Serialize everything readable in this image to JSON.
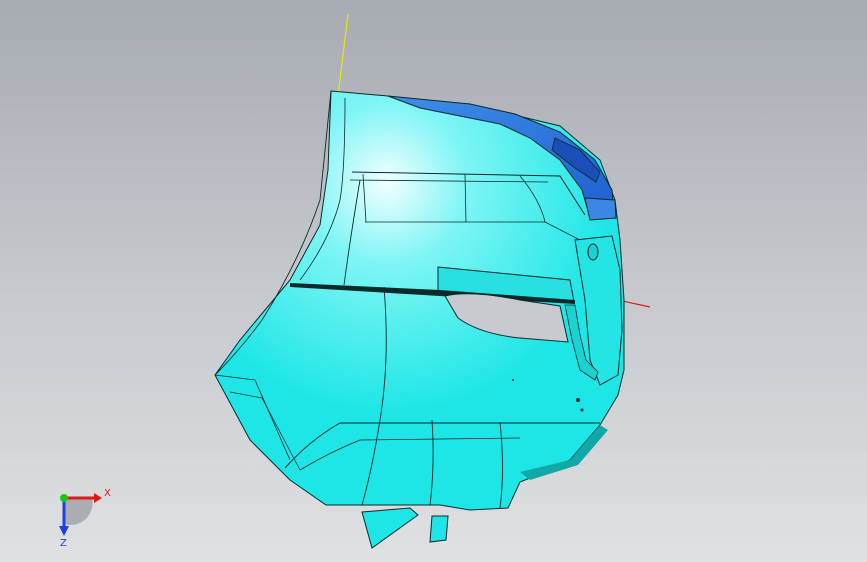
{
  "viewport": {
    "background_top": "#a7abb2",
    "background_bottom": "#dfe1e3"
  },
  "model": {
    "name": "",
    "body_color": "#1ee6e6",
    "highlight_color": "#e8ffff",
    "accent_color": "#2a6fd6",
    "edge_color": "#0b2a2a"
  },
  "triad": {
    "x_label": "X",
    "z_label": "Z",
    "x_color": "#e01818",
    "y_color": "#18c818",
    "z_color": "#2040e0"
  },
  "origin_axes": {
    "vertical_color": "#e8e800",
    "horizontal_color": "#e01818"
  }
}
